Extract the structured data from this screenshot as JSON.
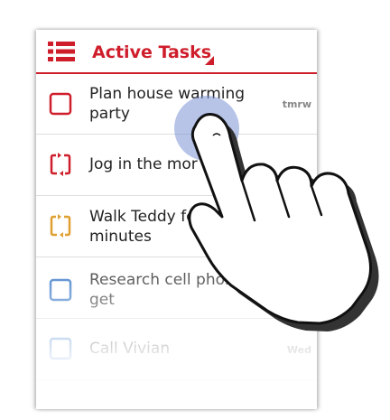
{
  "header": {
    "title": "Active Tasks"
  },
  "tasks": [
    {
      "label": "Plan house warming\nparty",
      "due": "tmrw",
      "icon": "checkbox-icon",
      "color": "#cf1e2b"
    },
    {
      "label": "Jog in the mor",
      "due": "",
      "icon": "repeat-task-icon",
      "color": "#cf1e2b"
    },
    {
      "label": "Walk Teddy for\nminutes",
      "due": "",
      "icon": "repeat-task-icon",
      "color": "#e0a030"
    },
    {
      "label": "Research cell phon\nget",
      "due": "",
      "icon": "checkbox-icon",
      "color": "#5b8fd0"
    },
    {
      "label": "Call Vivian",
      "due": "Wed",
      "icon": "checkbox-icon",
      "color": "#5b8fd0"
    }
  ],
  "colors": {
    "accent": "#cf1e2b",
    "touch_highlight": "#7b93d6"
  }
}
